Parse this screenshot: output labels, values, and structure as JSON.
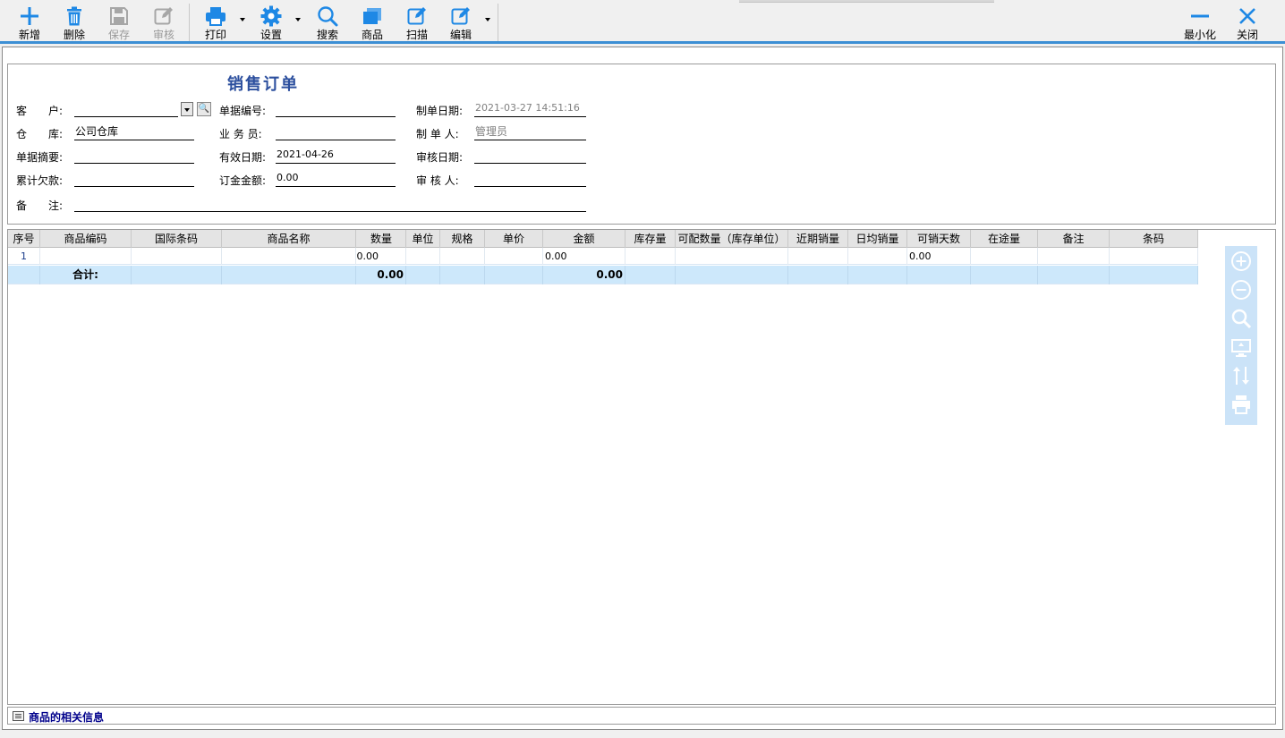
{
  "toolbar": {
    "add": "新增",
    "delete": "删除",
    "save": "保存",
    "audit": "审核",
    "print": "打印",
    "settings": "设置",
    "search": "搜索",
    "goods": "商品",
    "scan": "扫描",
    "edit": "编辑",
    "minimize": "最小化",
    "close": "关闭"
  },
  "form": {
    "title": "销售订单",
    "customer_label": "客　　户:",
    "customer_value": "",
    "warehouse_label": "仓　　库:",
    "warehouse_value": "公司仓库",
    "summary_label": "单据摘要:",
    "summary_value": "",
    "debt_label": "累计欠款:",
    "debt_value": "",
    "note_label": "备　　注:",
    "note_value": "",
    "doc_no_label": "单据编号:",
    "doc_no_value": "",
    "salesman_label": "业 务 员:",
    "salesman_value": "",
    "valid_date_label": "有效日期:",
    "valid_date_value": "2021-04-26",
    "deposit_label": "订金金额:",
    "deposit_value": "0.00",
    "create_date_label": "制单日期:",
    "create_date_value": "2021-03-27 14:51:16",
    "creator_label": "制 单 人:",
    "creator_value": "管理员",
    "audit_date_label": "审核日期:",
    "audit_date_value": "",
    "auditor_label": "审 核 人:",
    "auditor_value": ""
  },
  "grid": {
    "columns": [
      "序号",
      "商品编码",
      "国际条码",
      "商品名称",
      "数量",
      "单位",
      "规格",
      "单价",
      "金额",
      "库存量",
      "可配数量（库存单位）",
      "近期销量",
      "日均销量",
      "可销天数",
      "在途量",
      "备注",
      "条码"
    ],
    "rows": [
      {
        "seq": "1",
        "qty": "0.00",
        "amount": "0.00",
        "days": "0.00"
      }
    ],
    "total": {
      "label": "合计:",
      "qty": "0.00",
      "amount": "0.00"
    }
  },
  "info_bar": {
    "label": "商品的相关信息"
  },
  "icons": [
    "plus-icon",
    "trash-icon",
    "floppy-icon",
    "audit-edit-icon",
    "printer-icon",
    "gear-icon",
    "search-icon",
    "goods-icon",
    "scan-edit-icon",
    "edit-icon",
    "minus-icon",
    "close-icon",
    "zoom-in-icon",
    "zoom-out-icon",
    "magnify-icon",
    "screen-icon",
    "sort-icon",
    "print-icon"
  ],
  "colors": {
    "accent": "#1e88e5",
    "title": "#2c4f9e",
    "total_row": "#cde8fb",
    "side_panel": "#cbe3f8"
  }
}
